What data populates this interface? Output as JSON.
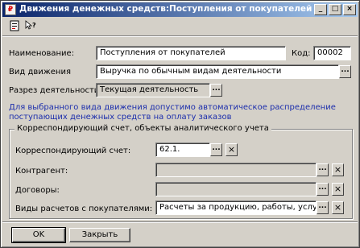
{
  "window": {
    "title": "Движения денежных средств:Поступления от покупателей *",
    "title_icon": "form-icon",
    "controls": [
      "_",
      "□",
      "×"
    ]
  },
  "toolbar": {
    "icons": [
      "document-icon",
      "help-cursor-icon"
    ]
  },
  "form": {
    "name_label": "Наименование:",
    "name_value": "Поступления от покупателей",
    "code_label": "Код:",
    "code_value": "00002",
    "movement_label": "Вид движения",
    "movement_value": "Выручка по обычным видам деятельности",
    "activity_label": "Разрез деятельности:",
    "activity_value": "Текущая деятельность",
    "dots": "...",
    "clear": "×"
  },
  "info_text": "Для выбранного вида движения допустимо автоматическое распределение поступающих денежных средств на оплату заказов",
  "group": {
    "title": "Корреспондирующий счет, объекты аналитического учета",
    "account_label": "Корреспондирующий счет:",
    "account_value": "62.1.",
    "counterparty_label": "Контрагент:",
    "counterparty_value": "",
    "contract_label": "Договоры:",
    "contract_value": "",
    "settlements_label": "Виды расчетов с покупателями:",
    "settlements_value": "Расчеты за продукцию, работы, услуги"
  },
  "buttons": {
    "ok": "OK",
    "close": "Закрыть"
  }
}
